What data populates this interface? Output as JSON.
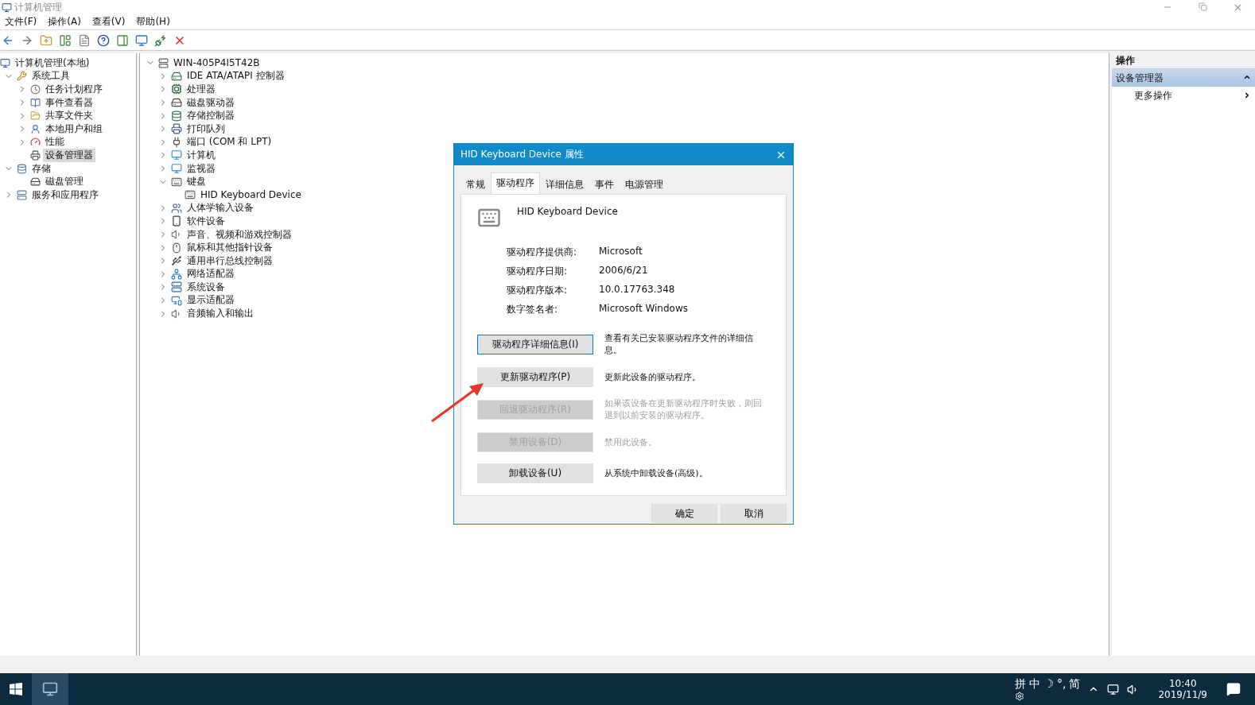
{
  "window": {
    "title": "计算机管理"
  },
  "menu": [
    "文件(F)",
    "操作(A)",
    "查看(V)",
    "帮助(H)"
  ],
  "left_tree": [
    {
      "label": "计算机管理(本地)",
      "selected": false,
      "children": [
        {
          "label": "系统工具",
          "expanded": true,
          "selected": false,
          "children": [
            {
              "label": "任务计划程序",
              "expanded": false,
              "selected": false
            },
            {
              "label": "事件查看器",
              "expanded": false,
              "selected": false
            },
            {
              "label": "共享文件夹",
              "expanded": false,
              "selected": false
            },
            {
              "label": "本地用户和组",
              "expanded": false,
              "selected": false
            },
            {
              "label": "性能",
              "expanded": false,
              "selected": false
            },
            {
              "label": "设备管理器",
              "selected": true
            }
          ]
        },
        {
          "label": "存储",
          "expanded": true,
          "selected": false,
          "children": [
            {
              "label": "磁盘管理",
              "selected": false
            }
          ]
        },
        {
          "label": "服务和应用程序",
          "expanded": false,
          "selected": false
        }
      ]
    }
  ],
  "device_tree": {
    "label": "WIN-405P4I5T42B",
    "expanded": true,
    "children": [
      {
        "label": "IDE ATA/ATAPI 控制器",
        "expanded": false
      },
      {
        "label": "处理器",
        "expanded": false
      },
      {
        "label": "磁盘驱动器",
        "expanded": false
      },
      {
        "label": "存储控制器",
        "expanded": false
      },
      {
        "label": "打印队列",
        "expanded": false
      },
      {
        "label": "端口 (COM 和 LPT)",
        "expanded": false
      },
      {
        "label": "计算机",
        "expanded": false
      },
      {
        "label": "监视器",
        "expanded": false
      },
      {
        "label": "键盘",
        "expanded": true,
        "children": [
          {
            "label": "HID Keyboard Device"
          }
        ]
      },
      {
        "label": "人体学输入设备",
        "expanded": false
      },
      {
        "label": "软件设备",
        "expanded": false
      },
      {
        "label": "声音、视频和游戏控制器",
        "expanded": false
      },
      {
        "label": "鼠标和其他指针设备",
        "expanded": false
      },
      {
        "label": "通用串行总线控制器",
        "expanded": false
      },
      {
        "label": "网络适配器",
        "expanded": false
      },
      {
        "label": "系统设备",
        "expanded": false
      },
      {
        "label": "显示适配器",
        "expanded": false
      },
      {
        "label": "音频输入和输出",
        "expanded": false
      }
    ]
  },
  "actions_panel": {
    "header": "操作",
    "section": "设备管理器",
    "expanded": true,
    "items": [
      "更多操作"
    ]
  },
  "dialog": {
    "title": "HID Keyboard Device 属性",
    "tabs": [
      {
        "label": "常规",
        "selected": false
      },
      {
        "label": "驱动程序",
        "selected": true
      },
      {
        "label": "详细信息",
        "selected": false
      },
      {
        "label": "事件",
        "selected": false
      },
      {
        "label": "电源管理",
        "selected": false
      }
    ],
    "device_name": "HID Keyboard Device",
    "info": [
      {
        "label": "驱动程序提供商:",
        "value": "Microsoft"
      },
      {
        "label": "驱动程序日期:",
        "value": "2006/6/21"
      },
      {
        "label": "驱动程序版本:",
        "value": "10.0.17763.348"
      },
      {
        "label": "数字签名者:",
        "value": "Microsoft Windows"
      }
    ],
    "actions": [
      {
        "button": "驱动程序详细信息(I)",
        "description": "查看有关已安装驱动程序文件的详细信息。",
        "disabled": false,
        "focused": true
      },
      {
        "button": "更新驱动程序(P)",
        "description": "更新此设备的驱动程序。",
        "disabled": false,
        "focused": false
      },
      {
        "button": "回退驱动程序(R)",
        "description": "如果该设备在更新驱动程序时失败，则回退到以前安装的驱动程序。",
        "disabled": true,
        "focused": false
      },
      {
        "button": "禁用设备(D)",
        "description": "禁用此设备。",
        "disabled": true,
        "focused": false
      },
      {
        "button": "卸载设备(U)",
        "description": "从系统中卸载设备(高级)。",
        "disabled": false,
        "focused": false
      }
    ],
    "buttons": [
      "确定",
      "取消"
    ]
  },
  "taskbar": {
    "ime": [
      "拼",
      "中",
      "☽",
      "°,",
      "简"
    ],
    "time": "10:40",
    "date": "2019/11/9"
  }
}
